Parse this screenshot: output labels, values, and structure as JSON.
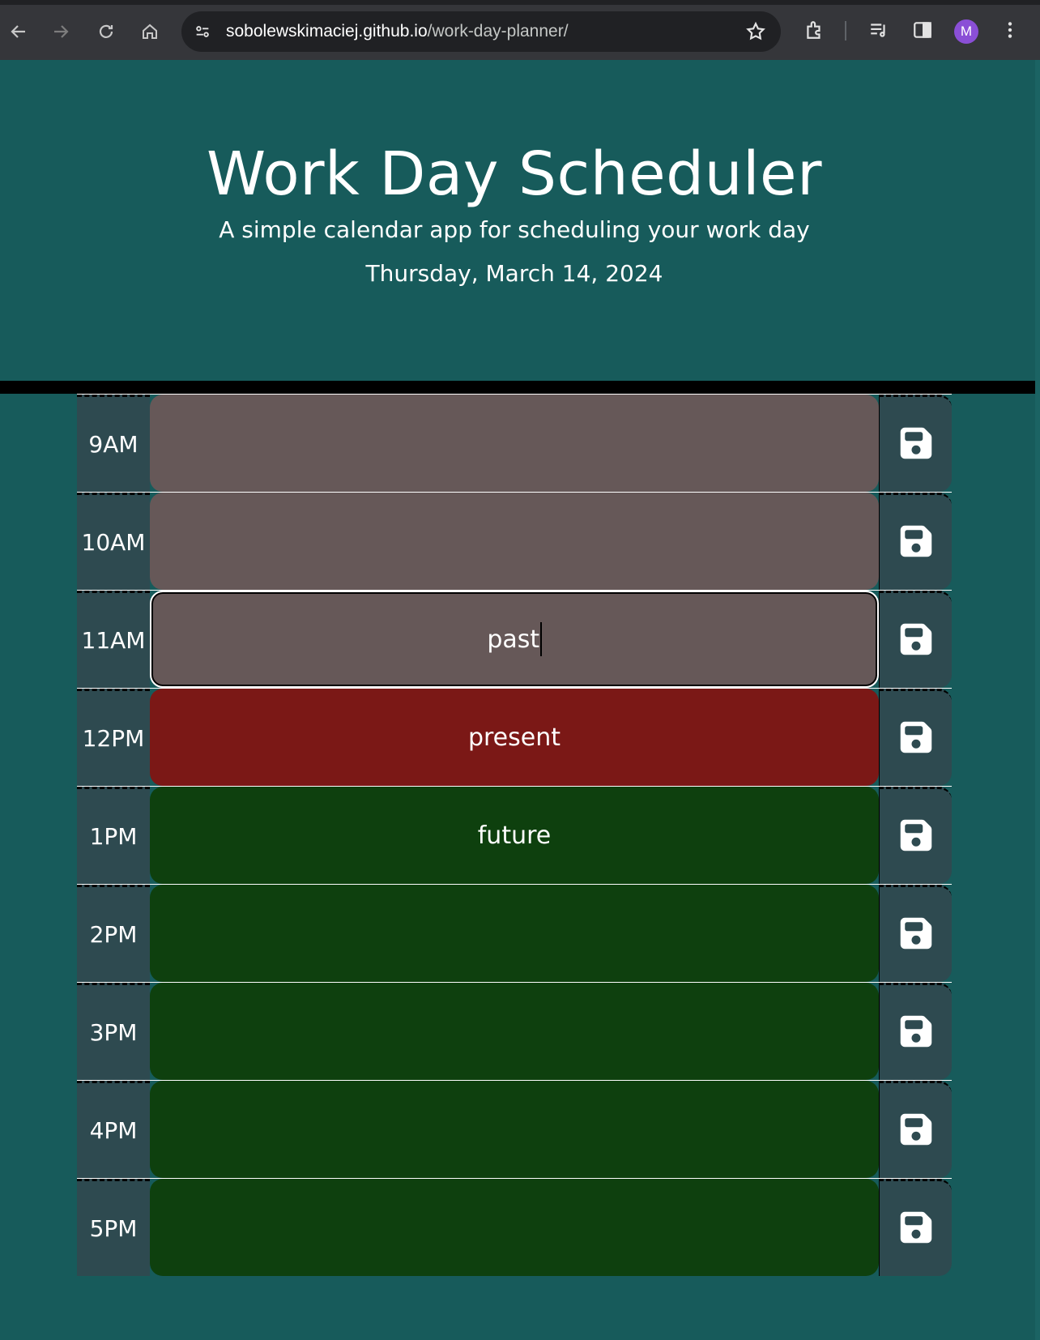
{
  "browser": {
    "url_host": "sobolewskimaciej.github.io",
    "url_path": "/work-day-planner/",
    "profile_initial": "M"
  },
  "header": {
    "title": "Work Day Scheduler",
    "subtitle": "A simple calendar app for scheduling your work day",
    "current_day": "Thursday, March 14, 2024"
  },
  "colors": {
    "background": "#175b5b",
    "past": "#665858",
    "present": "#7b1816",
    "future": "#0e400e",
    "hour_cell": "#2e4a50"
  },
  "time_blocks": [
    {
      "hour": "9AM",
      "text": "",
      "state": "past"
    },
    {
      "hour": "10AM",
      "text": "",
      "state": "past"
    },
    {
      "hour": "11AM",
      "text": "past",
      "state": "past"
    },
    {
      "hour": "12PM",
      "text": "present",
      "state": "present"
    },
    {
      "hour": "1PM",
      "text": "future",
      "state": "future"
    },
    {
      "hour": "2PM",
      "text": "",
      "state": "future"
    },
    {
      "hour": "3PM",
      "text": "",
      "state": "future"
    },
    {
      "hour": "4PM",
      "text": "",
      "state": "future"
    },
    {
      "hour": "5PM",
      "text": "",
      "state": "future"
    }
  ],
  "icons": {
    "save": "floppy-disk-icon"
  }
}
